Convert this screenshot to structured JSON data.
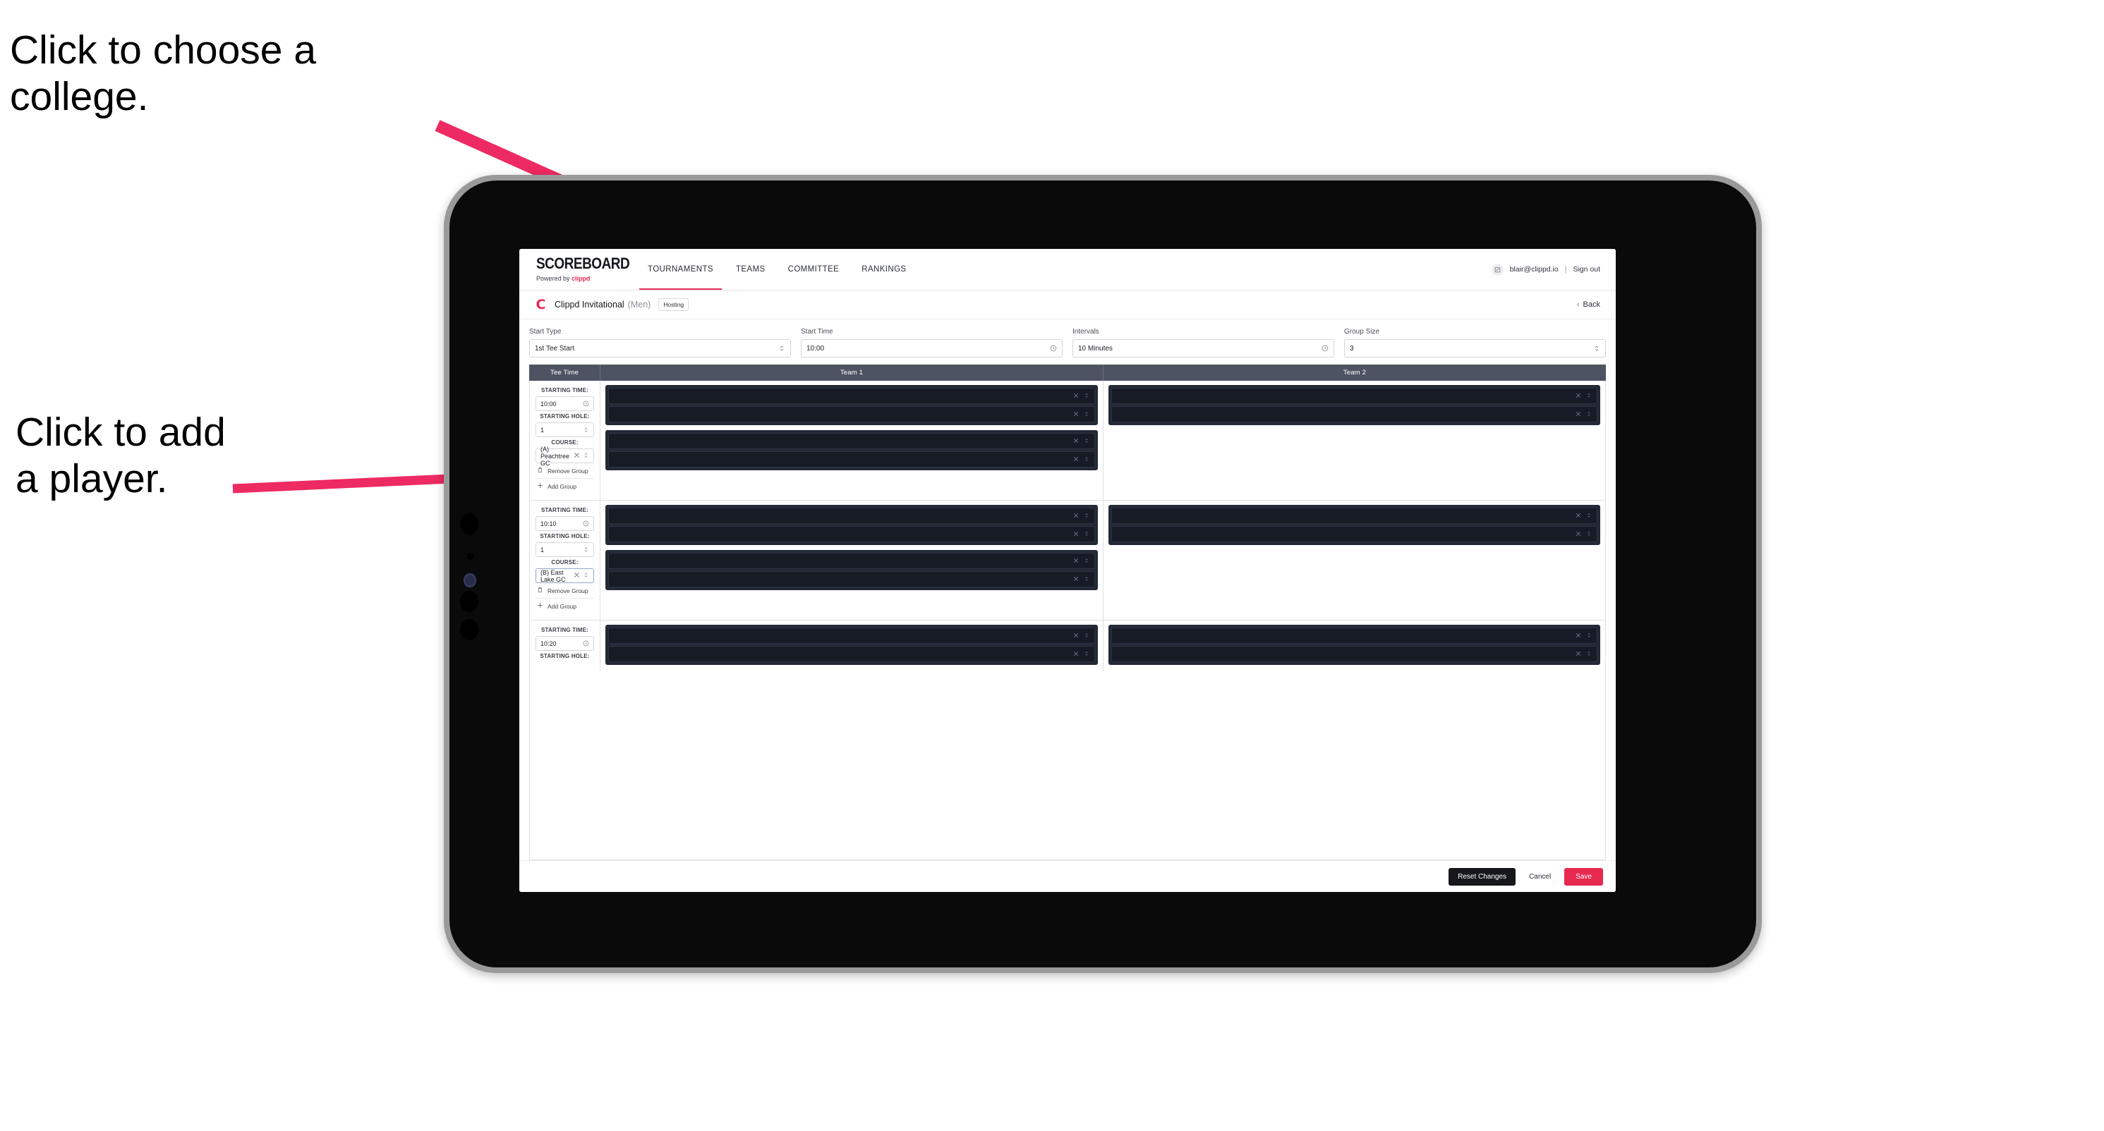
{
  "annotations": {
    "choose_college": "Click to choose a\ncollege.",
    "add_player": "Click to add\na player."
  },
  "colors": {
    "accent_pink": "#ea2a53",
    "annotation_arrow": "#ee2a62",
    "table_header_bg": "#4e5363",
    "player_row_bg": "#161b26",
    "save_button": "#e8294f",
    "reset_button": "#17181c"
  },
  "nav": {
    "brand_name": "SCOREBOARD",
    "brand_sub_prefix": "Powered by ",
    "brand_sub_accent": "clippd",
    "tabs": [
      {
        "label": "TOURNAMENTS",
        "active": true
      },
      {
        "label": "TEAMS",
        "active": false
      },
      {
        "label": "COMMITTEE",
        "active": false
      },
      {
        "label": "RANKINGS",
        "active": false
      }
    ],
    "user_email": "blair@clippd.io",
    "separator": "|",
    "sign_out": "Sign out",
    "avatar_icon": "user-avatar-icon"
  },
  "tournament": {
    "logo_glyph": "C",
    "name": "Clippd Invitational",
    "gender": "(Men)",
    "role_badge": "Hosting",
    "back_label": "Back",
    "back_chevron": "‹"
  },
  "controls": [
    {
      "label": "Start Type",
      "value": "1st Tee Start",
      "icon": "stepper-icon"
    },
    {
      "label": "Start Time",
      "value": "10:00",
      "icon": "clock-icon"
    },
    {
      "label": "Intervals",
      "value": "10 Minutes",
      "icon": "clock-icon"
    },
    {
      "label": "Group Size",
      "value": "3",
      "icon": "stepper-icon"
    }
  ],
  "table": {
    "headers": {
      "tee_time": "Tee Time",
      "team1": "Team 1",
      "team2": "Team 2"
    },
    "field_labels": {
      "starting_time": "STARTING TIME:",
      "starting_hole": "STARTING HOLE:",
      "course": "COURSE:"
    },
    "group_actions": {
      "remove": "Remove Group",
      "add": "Add Group",
      "remove_icon": "trash-icon",
      "add_icon": "plus-icon"
    },
    "row_actions": {
      "clear_icon": "close-x-icon",
      "stepper_icon": "stepper-icon"
    },
    "rows": [
      {
        "starting_time": "10:00",
        "starting_hole": "1",
        "course": "(A) Peachtree GC",
        "course_focused": false,
        "team1_groups": [
          {
            "players": [
              "",
              ""
            ]
          },
          {
            "players": [
              "",
              ""
            ]
          }
        ],
        "team2_groups": [
          {
            "players": [
              "",
              ""
            ]
          }
        ]
      },
      {
        "starting_time": "10:10",
        "starting_hole": "1",
        "course": "(B) East Lake GC",
        "course_focused": true,
        "team1_groups": [
          {
            "players": [
              "",
              ""
            ]
          },
          {
            "players": [
              "",
              ""
            ]
          }
        ],
        "team2_groups": [
          {
            "players": [
              "",
              ""
            ]
          }
        ]
      },
      {
        "starting_time": "10:20",
        "starting_hole": "",
        "course": "",
        "course_focused": false,
        "team1_groups": [
          {
            "players": [
              "",
              ""
            ]
          }
        ],
        "team2_groups": [
          {
            "players": [
              "",
              ""
            ]
          }
        ]
      }
    ]
  },
  "footer": {
    "reset": "Reset Changes",
    "cancel": "Cancel",
    "save": "Save"
  }
}
